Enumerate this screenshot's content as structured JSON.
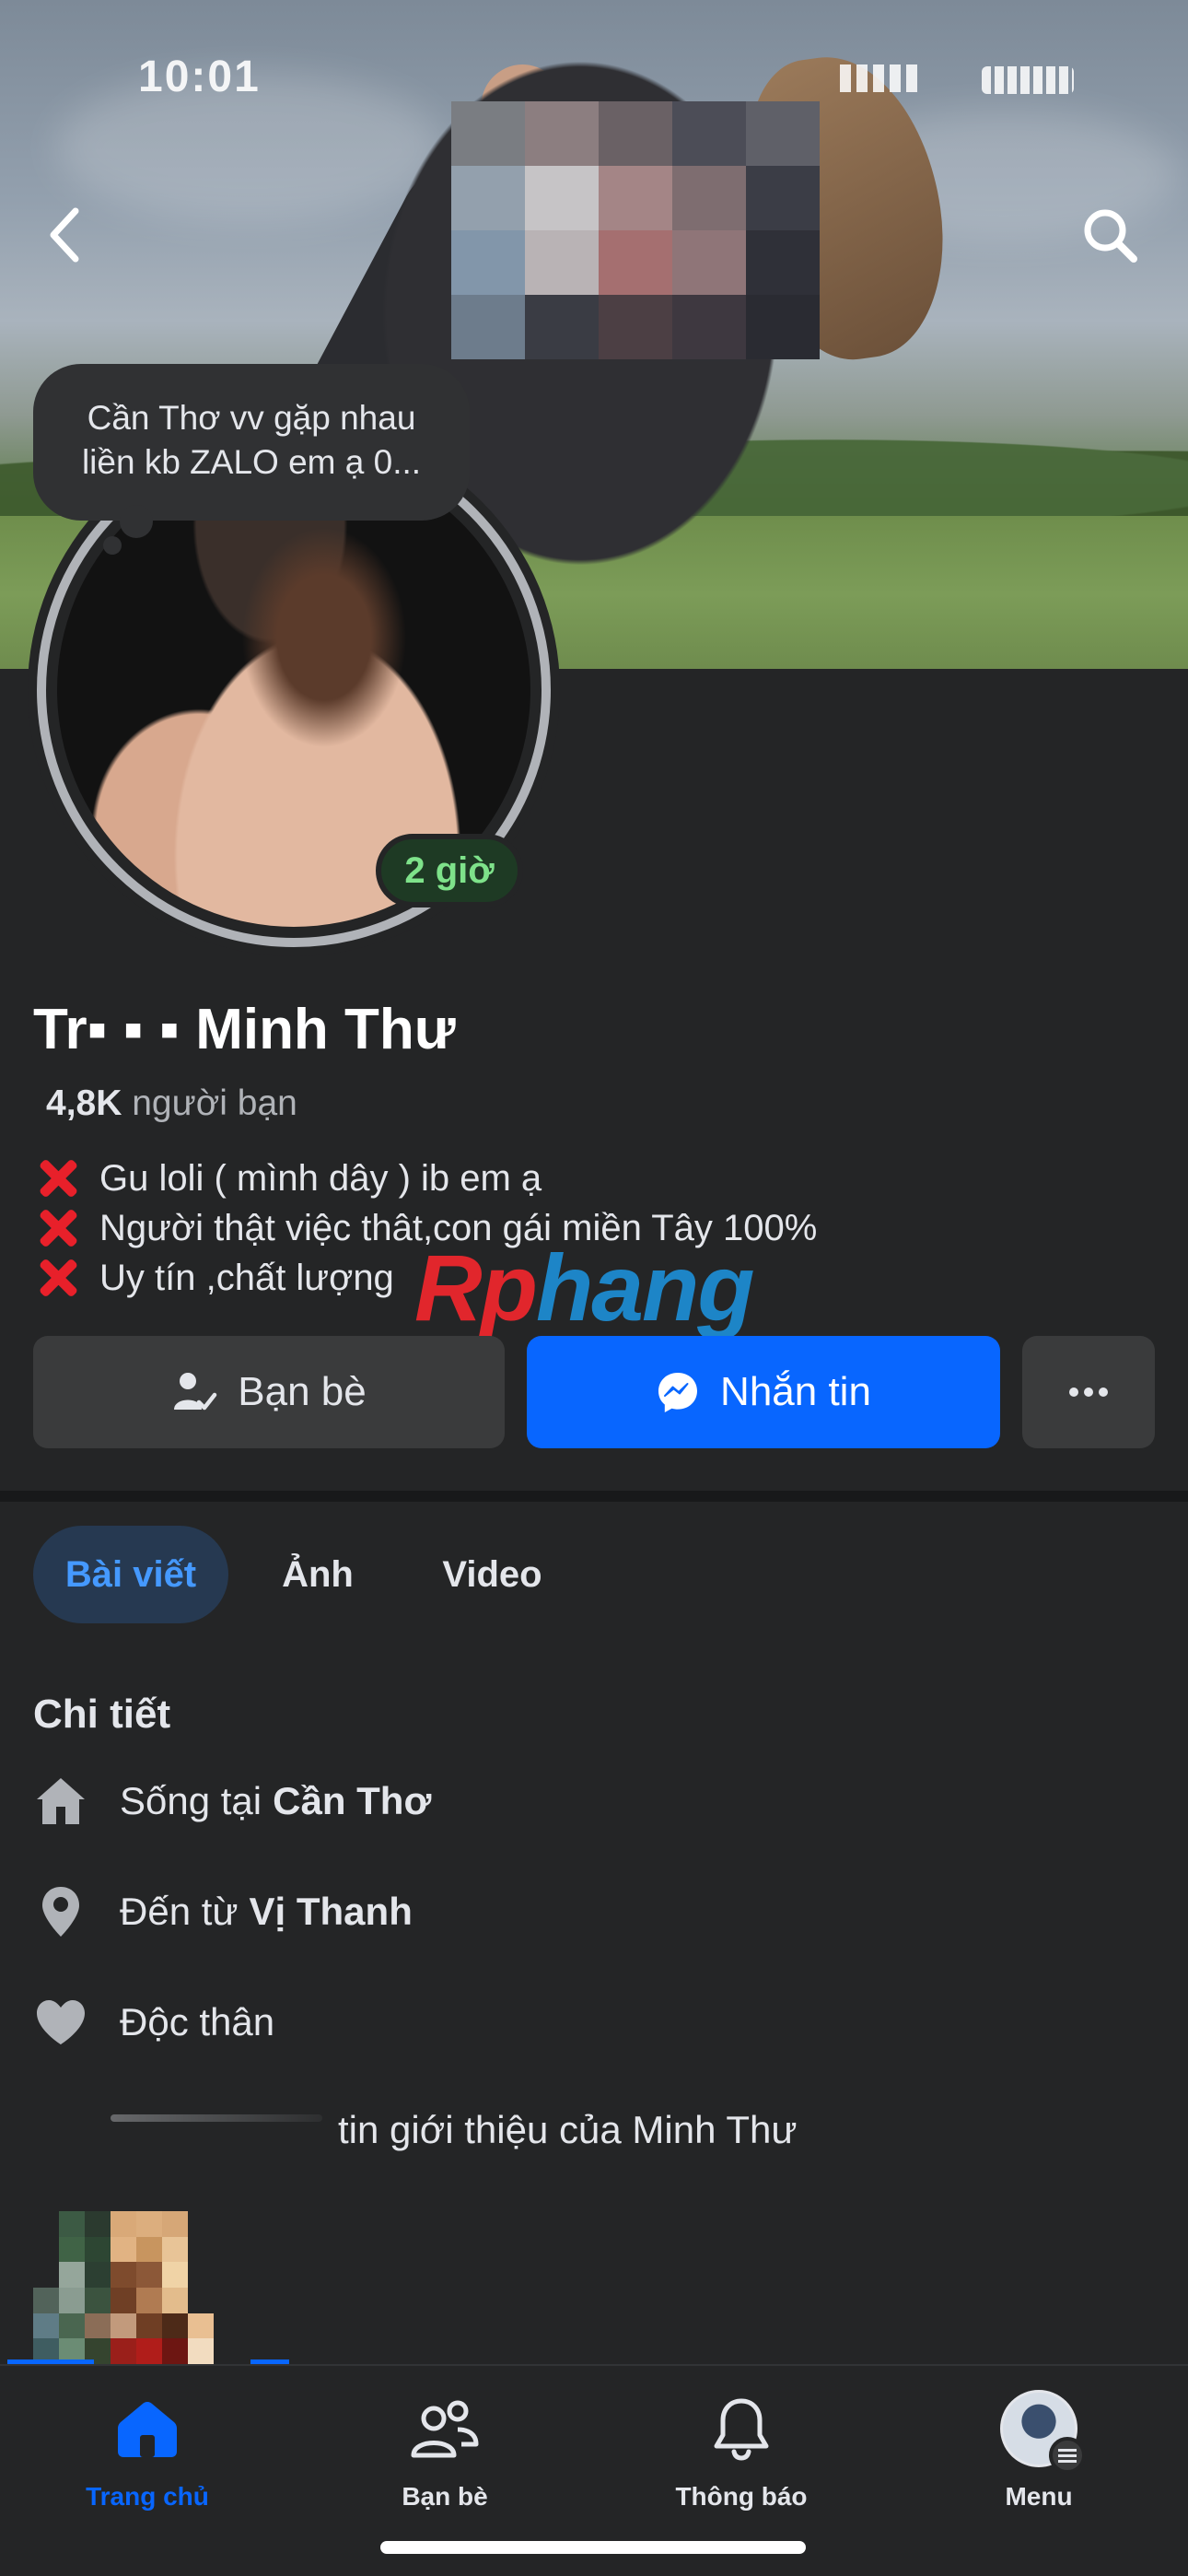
{
  "status_bar": {
    "time": "1⁣0:01"
  },
  "note": {
    "line1": "Cần Thơ vv gặp nhau",
    "line2": "liền kb ZALO em ạ 0..."
  },
  "story_badge": "2 giờ",
  "profile": {
    "name": "Tr▪ ▪ ▪ Minh Thư",
    "friends_count": "4,8K",
    "friends_label": "người bạn",
    "bio": [
      "Gu loli ( mình dây ) ib em ạ",
      "Người thật việc thât,con gái miền Tây 100%",
      "Uy tín ,chất lượng"
    ]
  },
  "watermark": {
    "part1": "Rp",
    "part2": "hang"
  },
  "actions": {
    "friends": "Bạn bè",
    "message": "Nhắn tin"
  },
  "tabs": [
    {
      "label": "Bài viết",
      "active": true
    },
    {
      "label": "Ảnh"
    },
    {
      "label": "Video"
    }
  ],
  "details": {
    "title": "Chi tiết",
    "lives_prefix": "Sống tại",
    "lives_value": "Cần Thơ",
    "from_prefix": "Đến từ",
    "from_value": "Vị Thanh",
    "relationship": "Độc thân",
    "see_about": "tin giới thiệu của Minh Thư"
  },
  "bottom_nav": [
    {
      "label": "Trang chủ",
      "icon": "home-icon",
      "active": true
    },
    {
      "label": "Bạn bè",
      "icon": "friends-icon"
    },
    {
      "label": "Thông báo",
      "icon": "bell-icon"
    },
    {
      "label": "Menu",
      "icon": "profile-avatar"
    }
  ],
  "colors": {
    "accent": "#0866ff",
    "background": "#242526",
    "badge_green": "#7ee28a",
    "bio_x": "#e8202a"
  }
}
